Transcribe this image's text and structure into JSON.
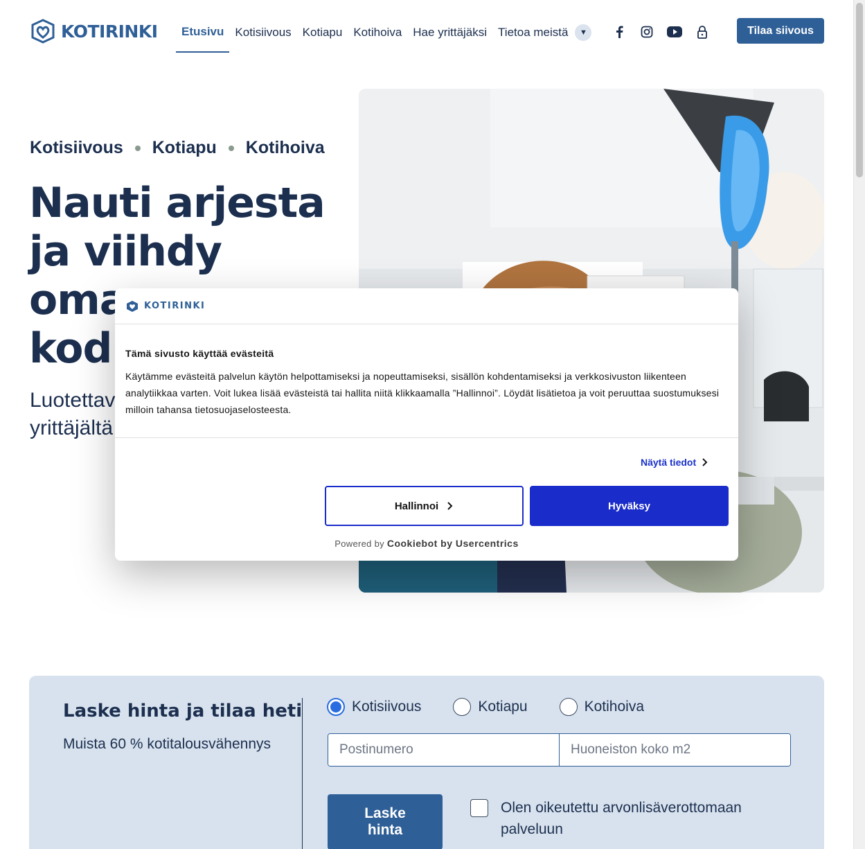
{
  "header": {
    "logo_text": "KOTIRINKI",
    "nav": [
      {
        "label": "Etusivu",
        "active": true
      },
      {
        "label": "Kotisiivous",
        "active": false
      },
      {
        "label": "Kotiapu",
        "active": false
      },
      {
        "label": "Kotihoiva",
        "active": false
      },
      {
        "label": "Hae yrittäjäksi",
        "active": false
      },
      {
        "label": "Tietoa meistä",
        "active": false
      }
    ],
    "socials": [
      "facebook-icon",
      "instagram-icon",
      "youtube-icon",
      "lock-icon"
    ],
    "cta_label": "Tilaa siivous"
  },
  "hero": {
    "services": [
      "Kotisiivous",
      "Kotiapu",
      "Kotihoiva"
    ],
    "title": "Nauti arjesta ja viihdy omassa kodissasi",
    "subtitle": "Luotettavaa apua paikalliselta yrittäjältä"
  },
  "price": {
    "title": "Laske hinta ja tilaa heti",
    "note": "Muista 60 % kotitalousvähennys",
    "radios": [
      {
        "label": "Kotisiivous",
        "selected": true
      },
      {
        "label": "Kotiapu",
        "selected": false
      },
      {
        "label": "Kotihoiva",
        "selected": false
      }
    ],
    "postal_placeholder": "Postinumero",
    "size_placeholder": "Huoneiston koko m2",
    "calc_label": "Laske hinta",
    "vat_label": "Olen oikeutettu arvonlisäverottomaan palveluun"
  },
  "cookie": {
    "logo_text": "KOTIRINKI",
    "title": "Tämä sivusto käyttää evästeitä",
    "text": "Käytämme evästeitä palvelun käytön helpottamiseksi ja nopeuttamiseksi, sisällön kohdentamiseksi ja verkkosivuston liikenteen analytiikkaa varten. Voit lukea lisää evästeistä tai hallita niitä klikkaamalla ”Hallinnoi”. Löydät lisätietoa ja voit peruuttaa suostumuksesi milloin tahansa tietosuojaselosteesta.",
    "details_label": "Näytä tiedot",
    "manage_label": "Hallinnoi",
    "accept_label": "Hyväksy",
    "powered_prefix": "Powered by",
    "powered_brand": "Cookiebot by Usercentrics"
  },
  "colors": {
    "brand": "#2e5f97",
    "navy": "#1c2f4f",
    "cookie_accent": "#1a2cc9",
    "price_bg": "#d8e2ee"
  }
}
